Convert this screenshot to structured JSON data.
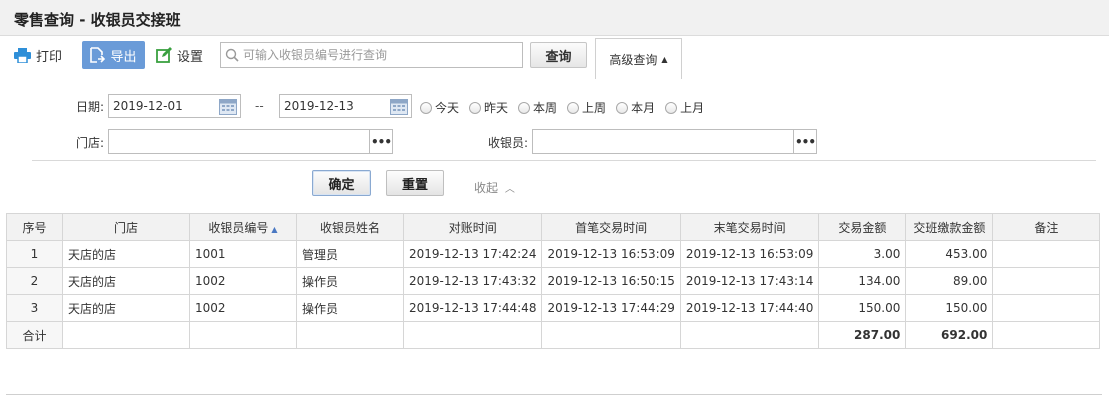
{
  "page": {
    "title": "零售查询 - 收银员交接班"
  },
  "toolbar": {
    "print_label": "打印",
    "export_label": "导出",
    "settings_label": "设置",
    "search_placeholder": "可输入收银员编号进行查询",
    "search_button": "查询",
    "advanced_label": "高级查询",
    "export_color": "#6a9bd8"
  },
  "filters": {
    "date_label": "日期:",
    "date_from": "2019-12-01",
    "date_sep": "--",
    "date_to": "2019-12-13",
    "quick_ranges": [
      "今天",
      "昨天",
      "本周",
      "上周",
      "本月",
      "上月"
    ],
    "store_label": "门店:",
    "store_value": "",
    "cashier_label": "收银员:",
    "cashier_value": "",
    "ok_button": "确定",
    "reset_button": "重置",
    "collapse_label": "收起"
  },
  "table": {
    "columns": [
      "序号",
      "门店",
      "收银员编号",
      "收银员姓名",
      "对账时间",
      "首笔交易时间",
      "末笔交易时间",
      "交易金额",
      "交班缴款金额",
      "备注"
    ],
    "sorted_column": "收银员编号",
    "rows": [
      [
        "1",
        "天店的店",
        "1001",
        "管理员",
        "2019-12-13 17:42:24",
        "2019-12-13 16:53:09",
        "2019-12-13 16:53:09",
        "3.00",
        "453.00",
        ""
      ],
      [
        "2",
        "天店的店",
        "1002",
        "操作员",
        "2019-12-13 17:43:32",
        "2019-12-13 16:50:15",
        "2019-12-13 17:43:14",
        "134.00",
        "89.00",
        ""
      ],
      [
        "3",
        "天店的店",
        "1002",
        "操作员",
        "2019-12-13 17:44:48",
        "2019-12-13 17:44:29",
        "2019-12-13 17:44:40",
        "150.00",
        "150.00",
        ""
      ]
    ],
    "total": {
      "label": "合计",
      "amount": "287.00",
      "handover_amount": "692.00"
    }
  }
}
